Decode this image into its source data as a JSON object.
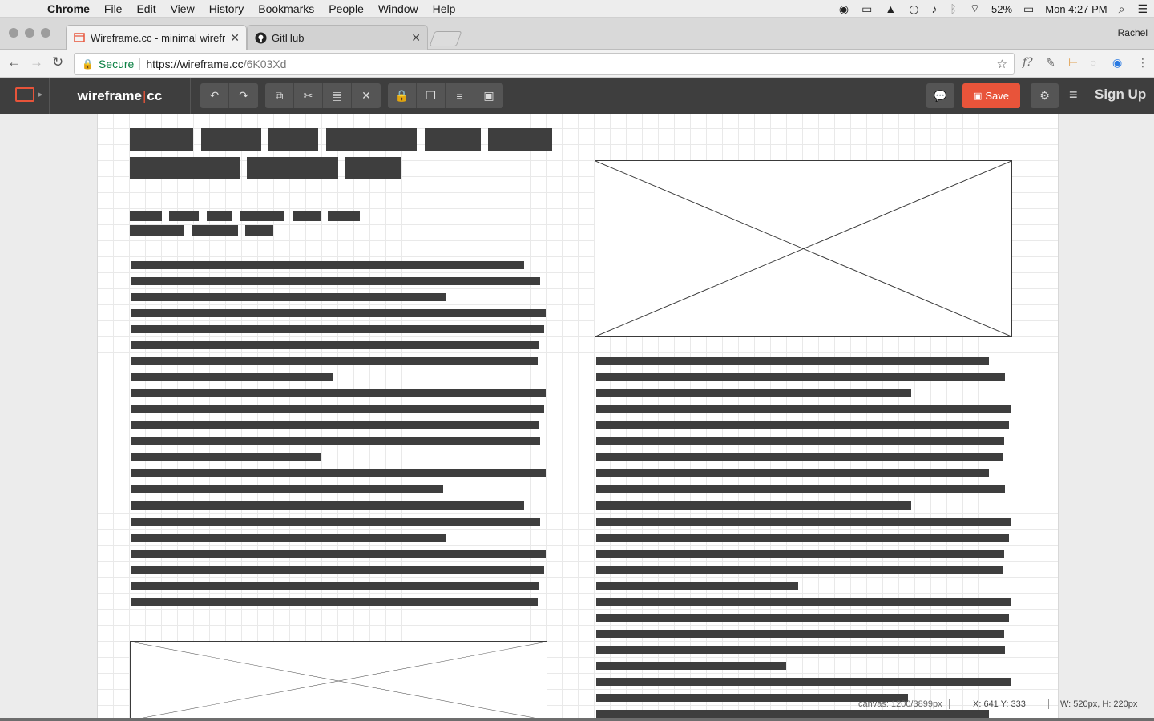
{
  "menubar": {
    "app": "Chrome",
    "items": [
      "File",
      "Edit",
      "View",
      "History",
      "Bookmarks",
      "People",
      "Window",
      "Help"
    ],
    "battery": "52%",
    "clock": "Mon 4:27 PM"
  },
  "tabs": [
    {
      "title": "Wireframe.cc - minimal wirefra",
      "icon": "wireframe-favicon"
    },
    {
      "title": "GitHub",
      "icon": "github-icon"
    }
  ],
  "profile": "Rachel",
  "address": {
    "secure_label": "Secure",
    "url_host": "https://wireframe.cc",
    "url_path": "/6K03Xd"
  },
  "app": {
    "brand_left": "wireframe",
    "brand_sep": "|",
    "brand_right": "cc",
    "save_label": "Save",
    "signup_label": "Sign Up"
  },
  "status": {
    "canvas": "canvas: 1200/3899px",
    "coords": "X: 641 Y: 333",
    "size": "W: 520px, H: 220px"
  },
  "colors": {
    "accent": "#e8543a",
    "toolbar": "#3e3e3e",
    "secure": "#0b8043"
  }
}
